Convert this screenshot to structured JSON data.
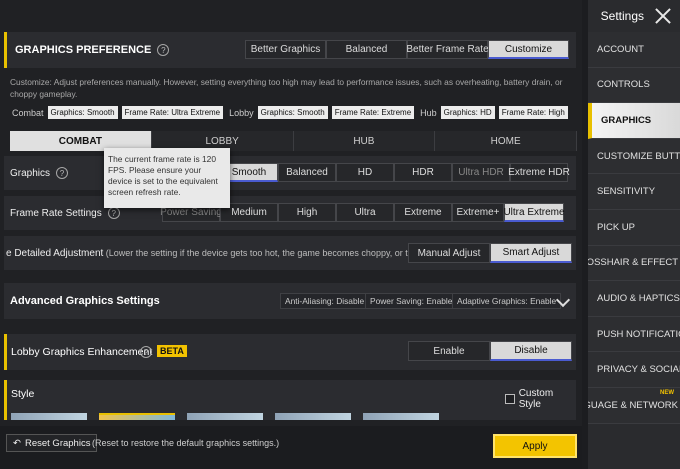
{
  "sidebar": {
    "title": "Settings",
    "items": [
      {
        "label": "ACCOUNT",
        "active": false,
        "new": false
      },
      {
        "label": "CONTROLS",
        "active": false,
        "new": false
      },
      {
        "label": "GRAPHICS",
        "active": true,
        "new": false
      },
      {
        "label": "CUSTOMIZE BUTTON",
        "active": false,
        "new": false
      },
      {
        "label": "SENSITIVITY",
        "active": false,
        "new": false
      },
      {
        "label": "PICK UP",
        "active": false,
        "new": false
      },
      {
        "label": "CROSSHAIR & EFFECT",
        "active": false,
        "new": false
      },
      {
        "label": "AUDIO & HAPTICS",
        "active": false,
        "new": false
      },
      {
        "label": "PUSH NOTIFICATION",
        "active": false,
        "new": false
      },
      {
        "label": "PRIVACY & SOCIAL",
        "active": false,
        "new": false
      },
      {
        "label": "LANGUAGE & NETWORK",
        "active": false,
        "new": true,
        "badge": "NEW"
      }
    ]
  },
  "preference": {
    "title": "GRAPHICS PREFERENCE",
    "options": [
      "Better Graphics",
      "Balanced",
      "Better Frame Rate",
      "Customize"
    ],
    "selected": "Customize",
    "description": "Customize: Adjust preferences manually. However, setting everything too high may lead to performance issues, such as overheating, battery drain, or choppy gameplay."
  },
  "summary": {
    "groups": [
      {
        "label": "Combat",
        "tags": [
          "Graphics: Smooth",
          "Frame Rate: Ultra Extreme"
        ]
      },
      {
        "label": "Lobby",
        "tags": [
          "Graphics: Smooth",
          "Frame Rate: Extreme"
        ]
      },
      {
        "label": "Hub",
        "tags": [
          "Graphics: HD",
          "Frame Rate: High"
        ]
      }
    ]
  },
  "mode_tabs": [
    "COMBAT",
    "LOBBY",
    "HUB",
    "HOME"
  ],
  "graphics": {
    "label": "Graphics",
    "options": [
      "Smooth",
      "Balanced",
      "HD",
      "HDR",
      "Ultra HDR",
      "Extreme HDR"
    ],
    "selected": "Smooth"
  },
  "tooltip": {
    "text": "The current frame rate is 120 FPS. Please ensure your device is set to the equivalent screen refresh rate."
  },
  "frame_rate": {
    "label": "Frame Rate Settings",
    "options": [
      "Power Saving",
      "Medium",
      "High",
      "Ultra",
      "Extreme",
      "Extreme+",
      "Ultra Extreme"
    ],
    "selected": "Ultra Extreme"
  },
  "detailed": {
    "label": "e Detailed Adjustment",
    "sub": " (Lower the setting if the device gets too hot, the game becomes choppy, or the battery",
    "options": [
      "Manual Adjust",
      "Smart Adjust"
    ],
    "selected": "Smart Adjust"
  },
  "advanced": {
    "title": "Advanced Graphics Settings",
    "chips": [
      "Anti-Aliasing: Disable",
      "Power Saving: Enable",
      "Adaptive Graphics: Enable"
    ]
  },
  "lobby_enh": {
    "title": "Lobby Graphics Enhancement",
    "badge": "BETA",
    "options": [
      "Enable",
      "Disable"
    ],
    "selected": "Disable"
  },
  "style": {
    "title": "Style",
    "custom_label": "Custom Style"
  },
  "bottom": {
    "reset_label": "Reset Graphics",
    "reset_note": "(Reset to restore the default graphics settings.)",
    "apply_label": "Apply"
  },
  "colors": {
    "accent": "#e8c000",
    "selected_underline": "#4a5bd0",
    "apply": "#f3c400"
  }
}
